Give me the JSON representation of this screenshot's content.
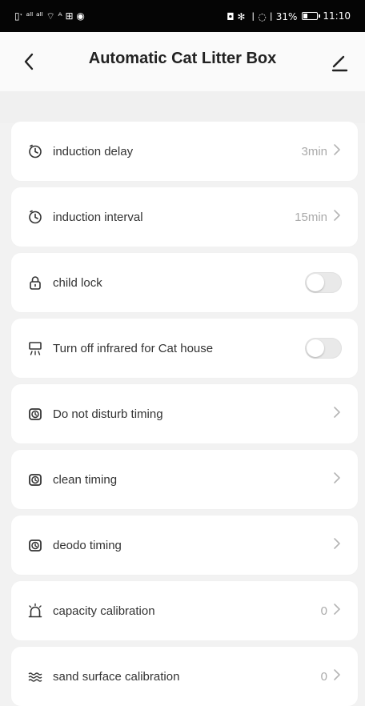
{
  "status_bar": {
    "left_text": "▯ˑ ᵃˡˡ ᵃˡˡ ⌔ ᴬ ⊞ ◉",
    "right_text": "◘ ✻ 〡◌〡31%",
    "battery_percent": 31,
    "time": "11:10"
  },
  "header": {
    "title": "Automatic Cat Litter Box",
    "back_icon": "chevron-left-icon",
    "edit_icon": "pencil-icon"
  },
  "settings": [
    {
      "id": "induction-delay",
      "icon": "clock-icon",
      "label": "induction delay",
      "value": "3min",
      "control": "chevron"
    },
    {
      "id": "induction-interval",
      "icon": "clock-icon",
      "label": "induction interval",
      "value": "15min",
      "control": "chevron"
    },
    {
      "id": "child-lock",
      "icon": "lock-icon",
      "label": "child lock",
      "value": "",
      "control": "toggle",
      "state": false
    },
    {
      "id": "infrared-off",
      "icon": "infrared-icon",
      "label": "Turn off infrared for Cat house",
      "value": "",
      "control": "toggle",
      "state": false
    },
    {
      "id": "do-not-disturb",
      "icon": "alarm-icon",
      "label": "Do not disturb timing",
      "value": "",
      "control": "chevron"
    },
    {
      "id": "clean-timing",
      "icon": "alarm-icon",
      "label": "clean timing",
      "value": "",
      "control": "chevron"
    },
    {
      "id": "deodo-timing",
      "icon": "alarm-icon",
      "label": "deodo timing",
      "value": "",
      "control": "chevron"
    },
    {
      "id": "capacity-calibration",
      "icon": "siren-icon",
      "label": "capacity calibration",
      "value": "0",
      "control": "chevron"
    },
    {
      "id": "sand-surface-calibration",
      "icon": "waves-icon",
      "label": "sand surface calibration",
      "value": "0",
      "control": "chevron"
    }
  ]
}
